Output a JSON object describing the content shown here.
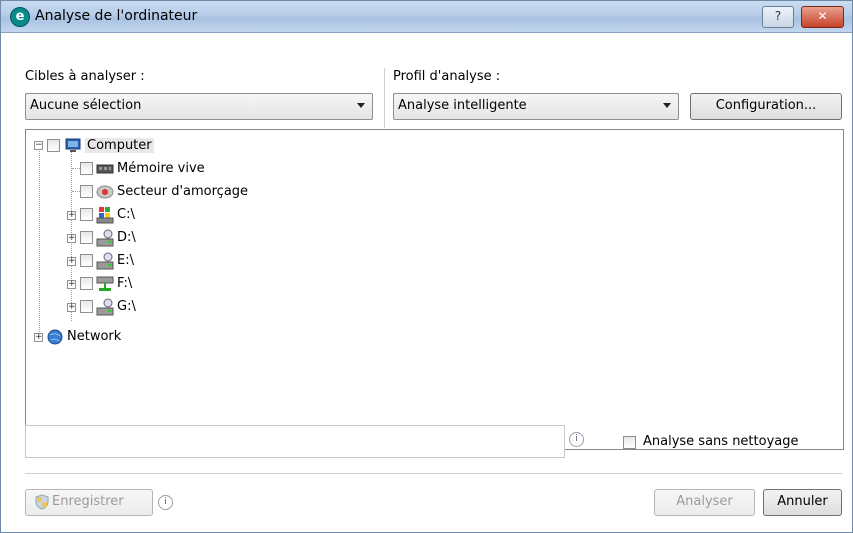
{
  "window": {
    "title": "Analyse de l'ordinateur",
    "app_icon_letter": "e",
    "help_button": "?",
    "close_button": "✕"
  },
  "targets": {
    "label": "Cibles à analyser :",
    "selected": "Aucune sélection"
  },
  "profile": {
    "label": "Profil d'analyse :",
    "selected": "Analyse intelligente",
    "config_button": "Configuration..."
  },
  "tree": {
    "root": "Computer",
    "items": [
      "Mémoire vive",
      "Secteur d'amorçage",
      "C:\\",
      "D:\\",
      "E:\\",
      "F:\\",
      "G:\\"
    ],
    "network": "Network"
  },
  "path_field": {
    "value": ""
  },
  "no_clean": {
    "label": "Analyse sans nettoyage",
    "checked": false
  },
  "footer": {
    "save_button": "Enregistrer",
    "scan_button": "Analyser",
    "cancel_button": "Annuler"
  }
}
